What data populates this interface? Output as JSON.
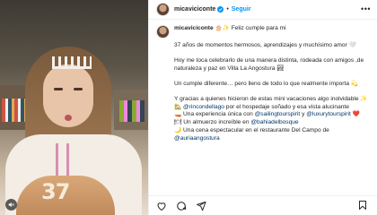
{
  "post": {
    "username": "micaviciconte",
    "follow_label": "Seguir",
    "separator": "•"
  },
  "caption": {
    "username": "micaviciconte",
    "first_line": "🎂✨ Feliz cumple para mi",
    "p1": "37 años de momentos hermosos, aprendizajes y muchísimo amor 🤍",
    "p2": "Hoy me toca celebrarlo de una manera distinta, rodeada con amigos ,de naturaleza y paz en Villa La Angostura 🏞",
    "p3": "Un cumple diferente… pero lleno de todo lo que realmente importa 💫",
    "p4": "Y gracias a quienes hicieron de estas mini vacaciones algo inolvidable ✨",
    "l1_pre": "🏡 ",
    "l1_mention": "@rincondellago",
    "l1_post": " por el hospedaje soñado y esa vista alucinante",
    "l2_pre": "🚤 Una experiencia única con ",
    "l2_mention1": "@sailingtourspirit",
    "l2_mid": " y ",
    "l2_mention2": "@luxurytourspirit",
    "l2_post": " ❤️",
    "l3_pre": "🍽 Un almuerzo increíble en ",
    "l3_mention": "@bahiadelbosque",
    "l4_pre": "🌙 Una cena espectacular en el restaurante Del Campo de ",
    "l4_mention": "@auriaangostura"
  },
  "media": {
    "cake_number": "37"
  },
  "icons": {
    "more": "more-horizontal-icon",
    "like": "heart-icon",
    "comment": "comment-icon",
    "share": "share-icon",
    "save": "bookmark-icon",
    "verified": "verified-badge-icon",
    "sound": "sound-off-icon"
  },
  "colors": {
    "link": "#00376b",
    "follow": "#0095f6",
    "verified": "#0095f6"
  }
}
